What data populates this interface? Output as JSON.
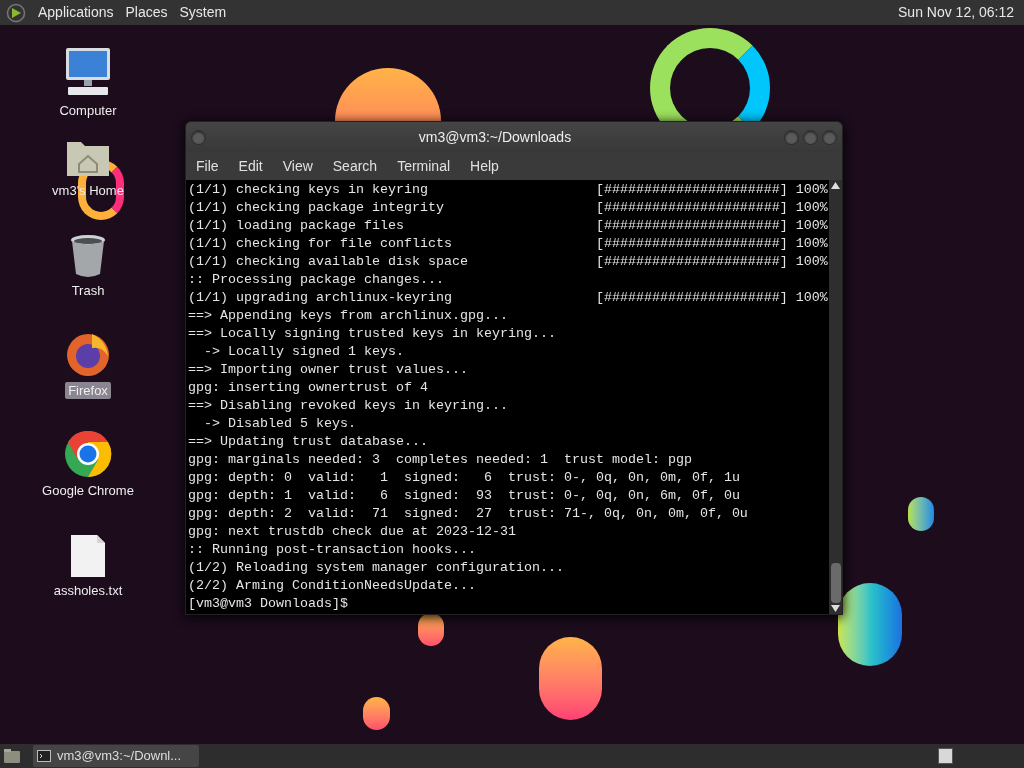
{
  "top_panel": {
    "menus": [
      "Applications",
      "Places",
      "System"
    ],
    "clock": "Sun Nov 12, 06:12"
  },
  "desktop_icons": [
    {
      "kind": "computer",
      "label": "Computer",
      "selected": false
    },
    {
      "kind": "home",
      "label": "vm3's Home",
      "selected": false
    },
    {
      "kind": "trash",
      "label": "Trash",
      "selected": false
    },
    {
      "kind": "firefox",
      "label": "Firefox",
      "selected": true
    },
    {
      "kind": "chrome",
      "label": "Google Chrome",
      "selected": false
    },
    {
      "kind": "textfile",
      "label": "assholes.txt",
      "selected": false
    }
  ],
  "terminal": {
    "title": "vm3@vm3:~/Downloads",
    "menus": [
      "File",
      "Edit",
      "View",
      "Search",
      "Terminal",
      "Help"
    ],
    "lines": [
      {
        "kind": "progress",
        "text": "(1/1) checking keys in keyring",
        "bar": "[######################]",
        "percent": "100%"
      },
      {
        "kind": "progress",
        "text": "(1/1) checking package integrity",
        "bar": "[######################]",
        "percent": "100%"
      },
      {
        "kind": "progress",
        "text": "(1/1) loading package files",
        "bar": "[######################]",
        "percent": "100%"
      },
      {
        "kind": "progress",
        "text": "(1/1) checking for file conflicts",
        "bar": "[######################]",
        "percent": "100%"
      },
      {
        "kind": "progress",
        "text": "(1/1) checking available disk space",
        "bar": "[######################]",
        "percent": "100%"
      },
      {
        "kind": "plain",
        "text": ":: Processing package changes..."
      },
      {
        "kind": "progress",
        "text": "(1/1) upgrading archlinux-keyring",
        "bar": "[######################]",
        "percent": "100%"
      },
      {
        "kind": "plain",
        "text": "==> Appending keys from archlinux.gpg..."
      },
      {
        "kind": "plain",
        "text": "==> Locally signing trusted keys in keyring..."
      },
      {
        "kind": "plain",
        "text": "  -> Locally signed 1 keys."
      },
      {
        "kind": "plain",
        "text": "==> Importing owner trust values..."
      },
      {
        "kind": "plain",
        "text": "gpg: inserting ownertrust of 4"
      },
      {
        "kind": "plain",
        "text": "==> Disabling revoked keys in keyring..."
      },
      {
        "kind": "plain",
        "text": "  -> Disabled 5 keys."
      },
      {
        "kind": "plain",
        "text": "==> Updating trust database..."
      },
      {
        "kind": "plain",
        "text": "gpg: marginals needed: 3  completes needed: 1  trust model: pgp"
      },
      {
        "kind": "plain",
        "text": "gpg: depth: 0  valid:   1  signed:   6  trust: 0-, 0q, 0n, 0m, 0f, 1u"
      },
      {
        "kind": "plain",
        "text": "gpg: depth: 1  valid:   6  signed:  93  trust: 0-, 0q, 0n, 6m, 0f, 0u"
      },
      {
        "kind": "plain",
        "text": "gpg: depth: 2  valid:  71  signed:  27  trust: 71-, 0q, 0n, 0m, 0f, 0u"
      },
      {
        "kind": "plain",
        "text": "gpg: next trustdb check due at 2023-12-31"
      },
      {
        "kind": "plain",
        "text": ":: Running post-transaction hooks..."
      },
      {
        "kind": "plain",
        "text": "(1/2) Reloading system manager configuration..."
      },
      {
        "kind": "plain",
        "text": "(2/2) Arming ConditionNeedsUpdate..."
      },
      {
        "kind": "prompt",
        "text": "[vm3@vm3 Downloads]$"
      }
    ]
  },
  "taskbar": {
    "tasks": [
      {
        "label": "vm3@vm3:~/Downl...",
        "selected": true
      }
    ]
  }
}
